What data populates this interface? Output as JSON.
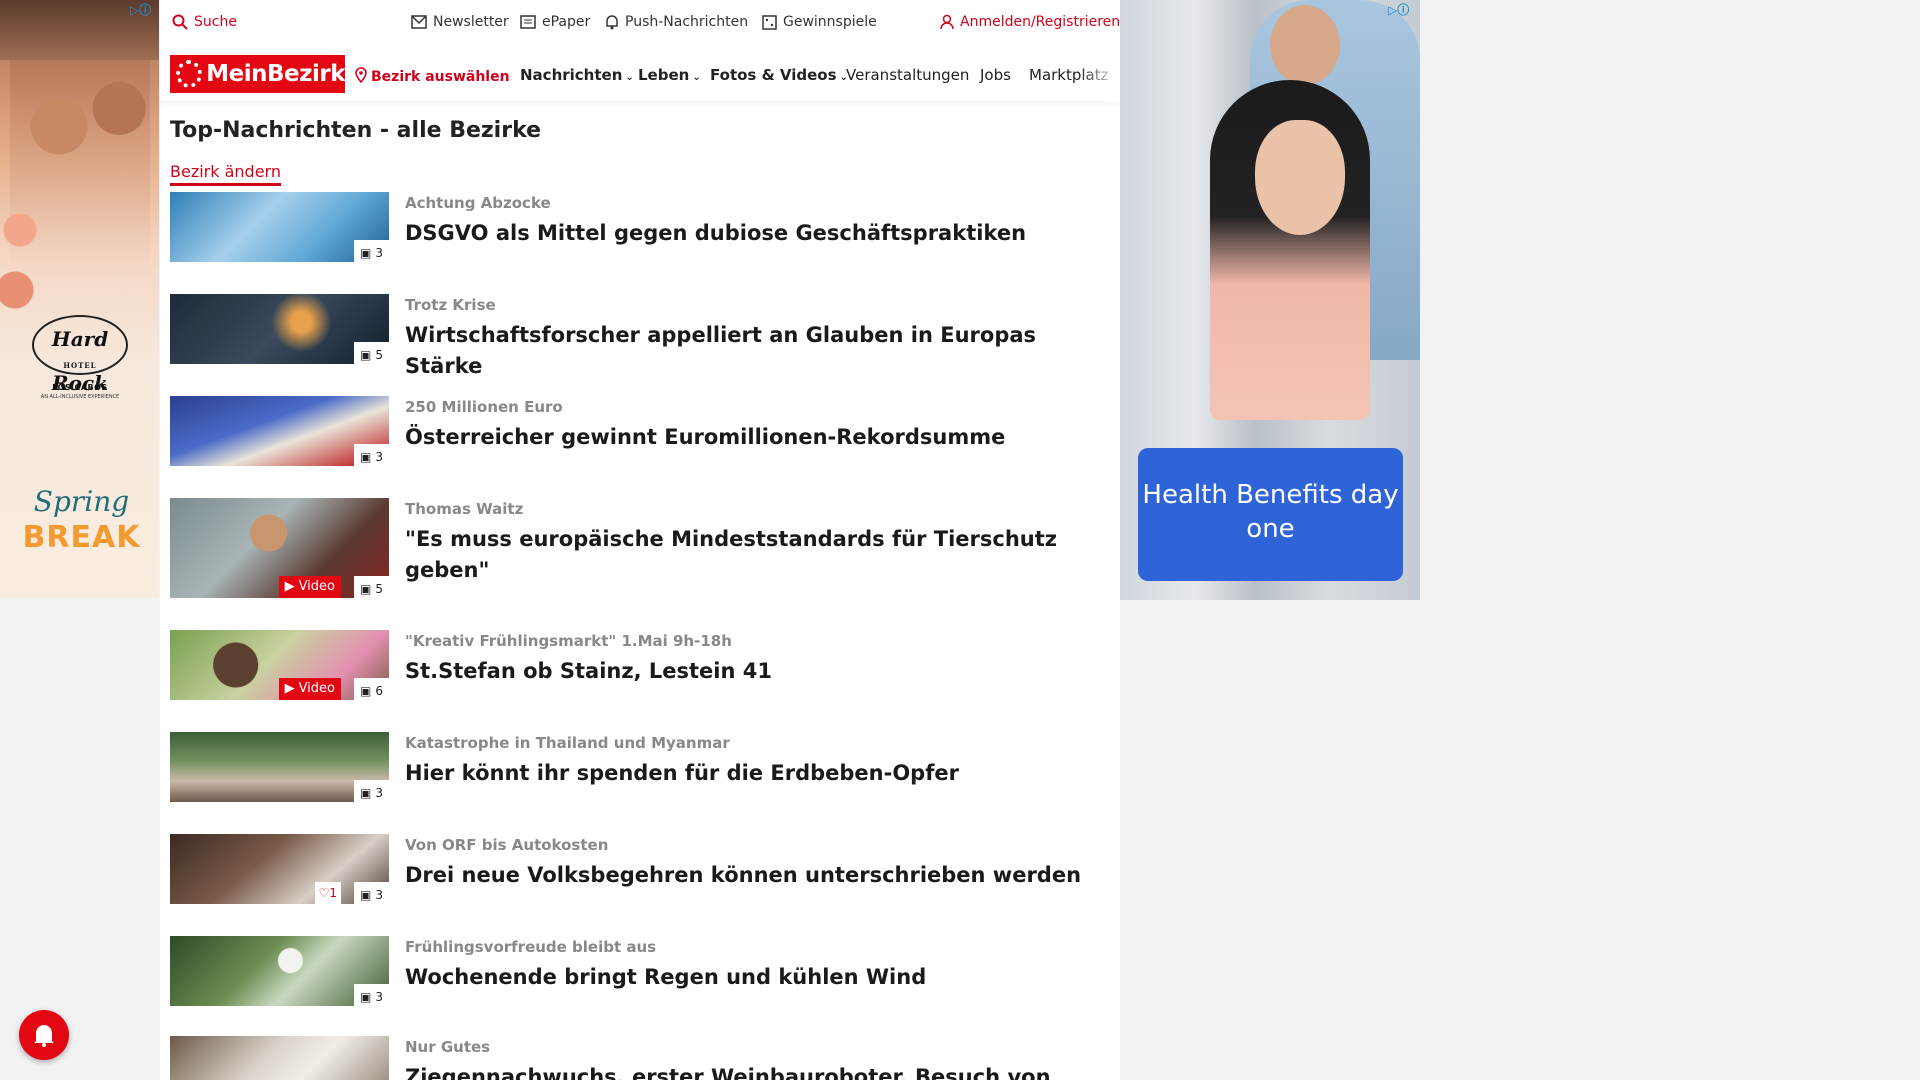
{
  "topbar": {
    "search": "Suche",
    "newsletter": "Newsletter",
    "epaper": "ePaper",
    "push": "Push-Nachrichten",
    "gewinnspiele": "Gewinnspiele",
    "login": "Anmelden/Registrieren"
  },
  "nav": {
    "logo": "MeinBezirk",
    "bezirk": "Bezirk auswählen",
    "items": [
      "Nachrichten",
      "Leben",
      "Fotos & Videos",
      "Veranstaltungen",
      "Jobs",
      "Marktplatz"
    ]
  },
  "page_title": "Top-Nachrichten - alle Bezirke",
  "change_bezirk": "Bezirk ändern",
  "articles": [
    {
      "kicker": "Achtung Abzocke",
      "headline": "DSGVO als Mittel gegen dubiose Geschäftspraktiken",
      "images": "3"
    },
    {
      "kicker": "Trotz Krise",
      "headline": "Wirtschaftsforscher appelliert an Glauben in Europas Stärke",
      "images": "5"
    },
    {
      "kicker": "250 Millionen Euro",
      "headline": "Österreicher gewinnt Euromillionen-Rekordsumme",
      "images": "3"
    },
    {
      "kicker": "Thomas Waitz",
      "headline": "\"Es muss europäische Mindeststandards für Tierschutz geben\"",
      "images": "5",
      "video": "Video"
    },
    {
      "kicker": "\"Kreativ Frühlingsmarkt\" 1.Mai 9h-18h",
      "headline": "St.Stefan ob Stainz, Lestein 41",
      "images": "6",
      "video": "Video"
    },
    {
      "kicker": "Katastrophe in Thailand und Myanmar",
      "headline": "Hier könnt ihr spenden für die Erdbeben-Opfer",
      "images": "3"
    },
    {
      "kicker": "Von ORF bis Autokosten",
      "headline": "Drei neue Volksbegehren können unterschrieben werden",
      "images": "3",
      "likes": "1"
    },
    {
      "kicker": "Frühlingsvorfreude bleibt aus",
      "headline": "Wochenende bringt Regen und kühlen Wind",
      "images": "3"
    },
    {
      "kicker": "Nur Gutes",
      "headline": "Ziegennachwuchs, erster Weinbauroboter, Besuch von"
    }
  ],
  "ads": {
    "left": {
      "brand": "Hard Rock",
      "brand_sub": "HOTEL",
      "place": "LOS CABOS",
      "tagline": "AN ALL-INCLUSIVE EXPERIENCE",
      "spring": "Spring",
      "break": "BREAK"
    },
    "right": {
      "cta": "Health Benefits day one"
    },
    "choices": "▷ⓘ"
  },
  "icons": {
    "search": "search-icon",
    "newsletter": "mail-icon",
    "epaper": "newspaper-icon",
    "push": "bell-icon",
    "gewinnspiele": "gift-icon",
    "login": "user-icon",
    "bezirk": "map-pin-icon",
    "images": "image-icon",
    "video": "play-icon",
    "likes": "heart-icon"
  },
  "colors": {
    "brand": "#e30613",
    "accent_red": "#d0021b",
    "cta_blue": "#2f64d8"
  }
}
